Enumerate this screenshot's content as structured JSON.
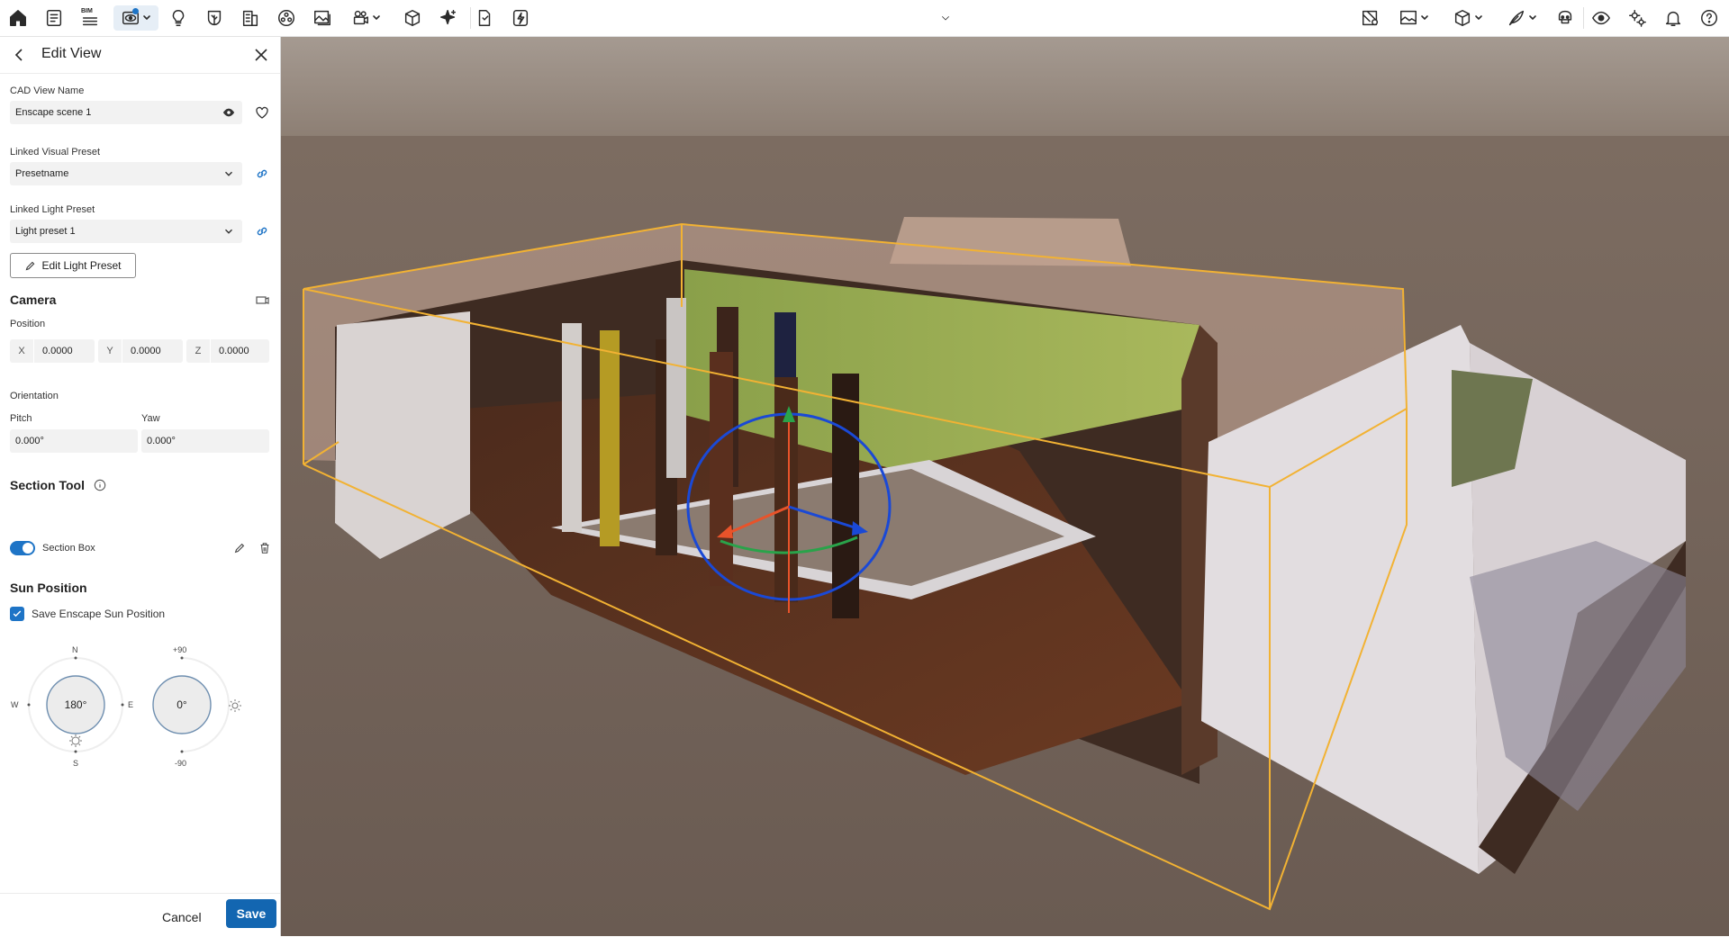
{
  "toolbar": {
    "bim_label": "BIM",
    "left_icons": [
      "home-icon",
      "notes-icon",
      "bim-list-icon",
      "view-eye-icon",
      "lightbulb-icon",
      "leaf-icon",
      "building-icon",
      "asset-library-icon",
      "image-icon",
      "video-icon",
      "cube-icon",
      "sparkle-icon",
      "document-export-icon",
      "bolt-icon"
    ],
    "right_icons": [
      "map-icon",
      "image-settings-icon",
      "cube-settings-icon",
      "feather-icon",
      "vr-headset-icon",
      "eye-icon",
      "settings-icon",
      "bell-icon",
      "help-icon"
    ]
  },
  "panel": {
    "title": "Edit View",
    "cad_view_name_label": "CAD View Name",
    "cad_view_name_value": "Enscape scene 1",
    "linked_visual_preset_label": "Linked Visual Preset",
    "linked_visual_preset_value": "Presetname",
    "linked_light_preset_label": "Linked Light Preset",
    "linked_light_preset_value": "Light preset 1",
    "edit_light_preset_button": "Edit Light Preset",
    "camera": {
      "title": "Camera",
      "position_label": "Position",
      "x_label": "X",
      "x_value": "0.0000",
      "y_label": "Y",
      "y_value": "0.0000",
      "z_label": "Z",
      "z_value": "0.0000",
      "orientation_label": "Orientation",
      "pitch_label": "Pitch",
      "pitch_value": "0.000°",
      "yaw_label": "Yaw",
      "yaw_value": "0.000°"
    },
    "section_tool": {
      "title": "Section Tool",
      "section_box_label": "Section Box",
      "enabled": true
    },
    "sun_position": {
      "title": "Sun Position",
      "save_label": "Save Enscape Sun Position",
      "checked": true,
      "compass": {
        "value": "180°",
        "n": "N",
        "s": "S",
        "e": "E",
        "w": "W"
      },
      "elevation": {
        "value": "0°",
        "top": "+90",
        "bottom": "-90"
      }
    },
    "footer": {
      "cancel": "Cancel",
      "save": "Save"
    }
  },
  "colors": {
    "accent": "#1366b1",
    "section_box": "#f2b233",
    "gizmo_blue": "#1a49d6",
    "gizmo_green": "#2aa34a",
    "gizmo_red": "#e8532a"
  }
}
